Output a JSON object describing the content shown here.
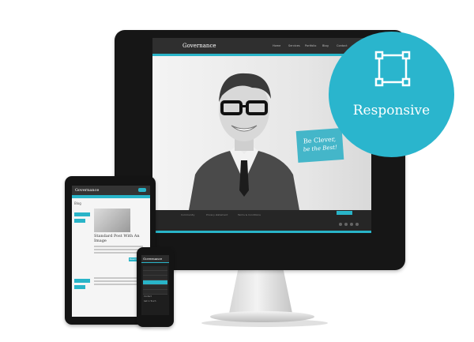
{
  "badge": {
    "label": "Responsive",
    "icon": "resize-frame-icon",
    "color": "#2ab5cd"
  },
  "desktop": {
    "logo": "Governance",
    "nav": [
      "Home",
      "Services",
      "Portfolio",
      "Blog",
      "Contact"
    ],
    "hero_tag_line1": "Be Clever,",
    "hero_tag_line2": "be the Best!",
    "footer_links": [
      "Community",
      "Privacy statement",
      "Terms & Conditions"
    ],
    "accent": "#29b4c8"
  },
  "tablet": {
    "logo": "Governance",
    "section": "Blog",
    "post_title": "Standard Post With An Image",
    "read_more": "Read More"
  },
  "phone": {
    "logo": "Governance",
    "menu": [
      "Home",
      "Features",
      "Blog",
      "Portfolio",
      "Contact",
      "Get in Touch"
    ]
  }
}
